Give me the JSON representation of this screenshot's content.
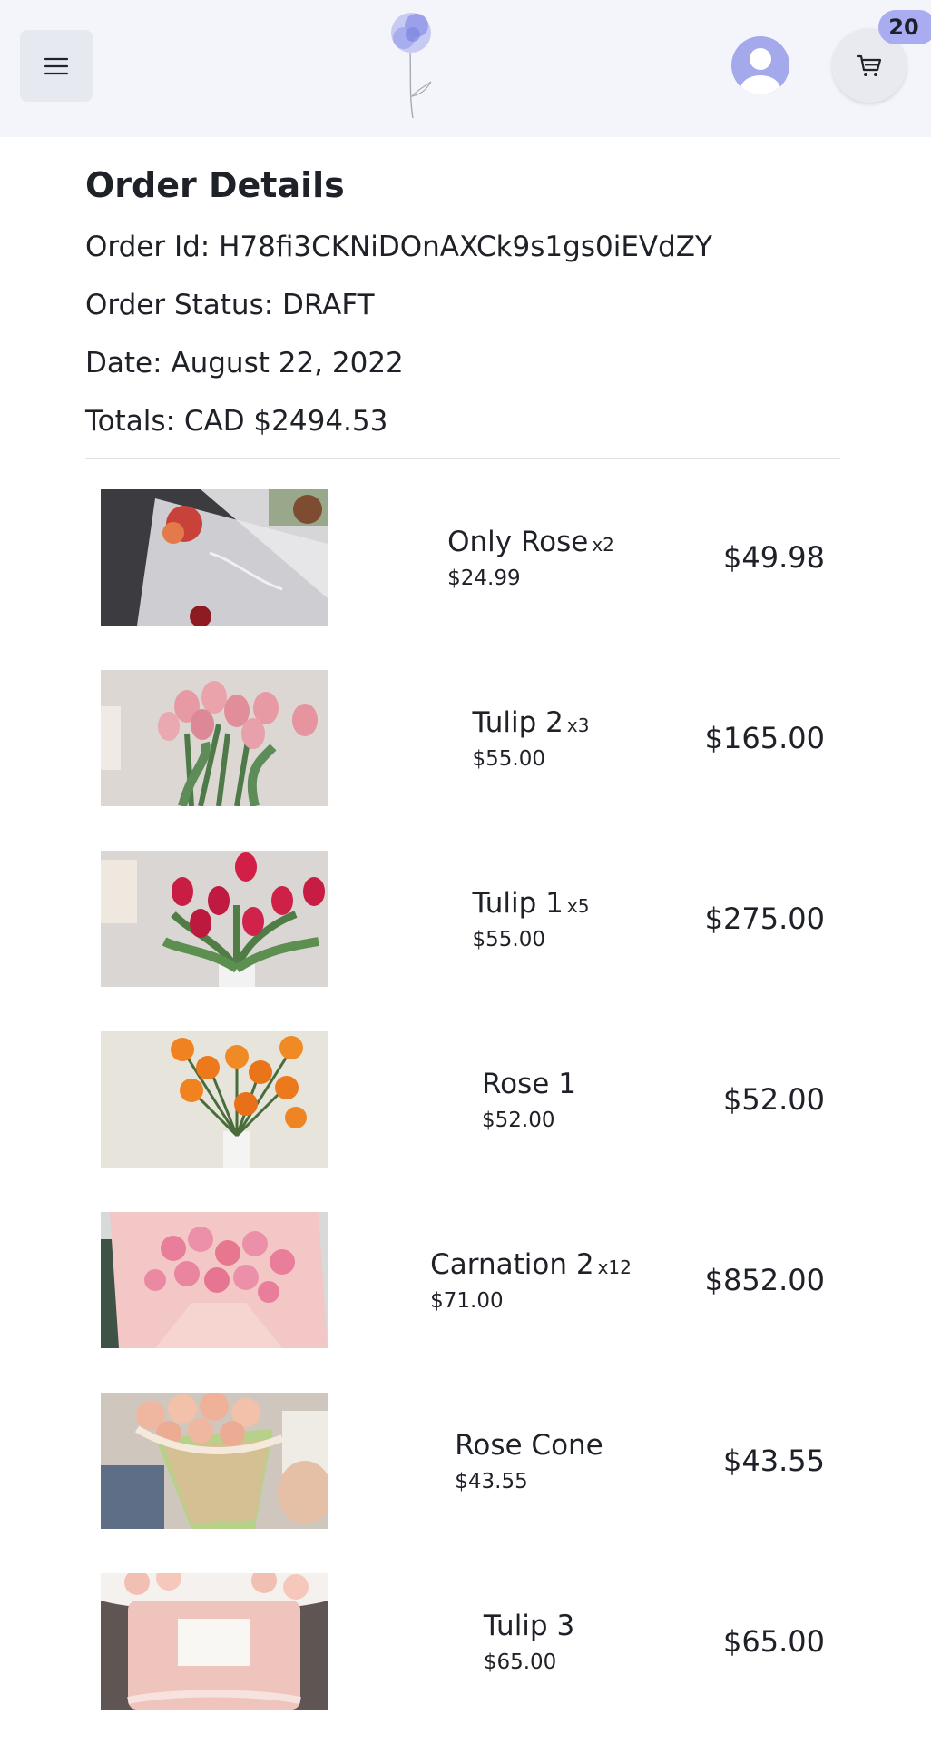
{
  "header": {
    "menu_icon": "hamburger-menu-icon",
    "logo_icon": "rose-logo-icon",
    "avatar_icon": "user-avatar-icon",
    "cart_icon": "shopping-cart-icon",
    "cart_count": "20",
    "accent_color": "#a9acf0"
  },
  "order": {
    "title": "Order Details",
    "id_line": "Order Id: H78fi3CKNiDOnAXCk9s1gs0iEVdZY",
    "status_line": "Order Status: DRAFT",
    "date_line": "Date: August 22, 2022",
    "totals_line": "Totals: CAD $2494.53"
  },
  "items": [
    {
      "name": "Only Rose",
      "qty": "x2",
      "unit_price": "$24.99",
      "total": "$49.98",
      "image": "rose-bouquet-photo"
    },
    {
      "name": "Tulip 2",
      "qty": "x3",
      "unit_price": "$55.00",
      "total": "$165.00",
      "image": "pink-tulips-photo"
    },
    {
      "name": "Tulip 1",
      "qty": "x5",
      "unit_price": "$55.00",
      "total": "$275.00",
      "image": "red-tulips-photo"
    },
    {
      "name": "Rose 1",
      "qty": "",
      "unit_price": "$52.00",
      "total": "$52.00",
      "image": "orange-roses-photo"
    },
    {
      "name": "Carnation 2",
      "qty": "x12",
      "unit_price": "$71.00",
      "total": "$852.00",
      "image": "pink-carnations-photo"
    },
    {
      "name": "Rose Cone",
      "qty": "",
      "unit_price": "$43.55",
      "total": "$43.55",
      "image": "rose-cone-photo"
    },
    {
      "name": "Tulip 3",
      "qty": "",
      "unit_price": "$65.00",
      "total": "$65.00",
      "image": "tulip-box-photo"
    }
  ]
}
